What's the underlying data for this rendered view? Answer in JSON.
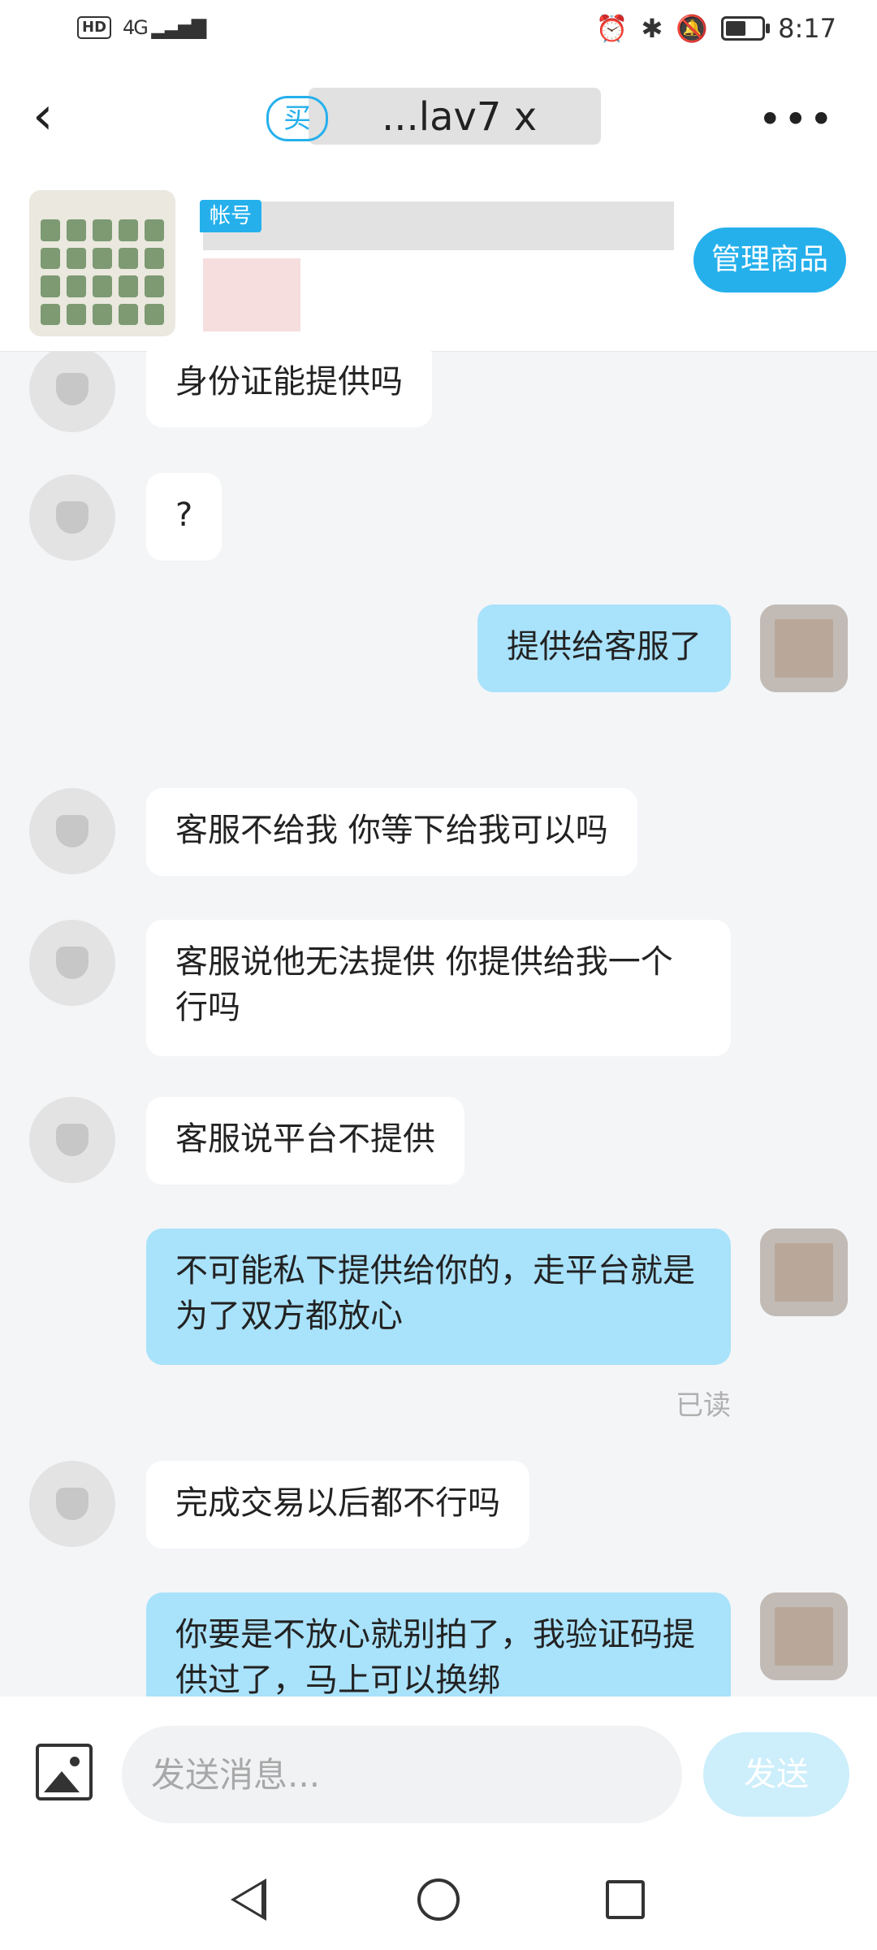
{
  "status_bar": {
    "network": "HD",
    "signal": "4G",
    "time": "8:17"
  },
  "header": {
    "buyer_tag": "买",
    "title": "...lav7 x"
  },
  "product": {
    "account_tag": "帐号",
    "manage_label": "管理商品"
  },
  "messages": [
    {
      "side": "in",
      "text": "身份证能提供吗"
    },
    {
      "side": "in",
      "text": "?"
    },
    {
      "side": "out",
      "text": "提供给客服了"
    },
    {
      "side": "in",
      "text": "客服不给我 你等下给我可以吗"
    },
    {
      "side": "in",
      "text": "客服说他无法提供 你提供给我一个行吗"
    },
    {
      "side": "in",
      "text": "客服说平台不提供"
    },
    {
      "side": "out",
      "text": "不可能私下提供给你的，走平台就是为了双方都放心"
    },
    {
      "side": "in",
      "text": "完成交易以后都不行吗"
    },
    {
      "side": "out",
      "text": "你要是不放心就别拍了，我验证码提供过了，马上可以换绑"
    }
  ],
  "read_label": "已读",
  "input": {
    "placeholder": "发送消息...",
    "send_label": "发送"
  },
  "colors": {
    "accent": "#25b0ec",
    "out_bubble": "#a9e2fb",
    "send_disabled": "#cdeefb"
  }
}
